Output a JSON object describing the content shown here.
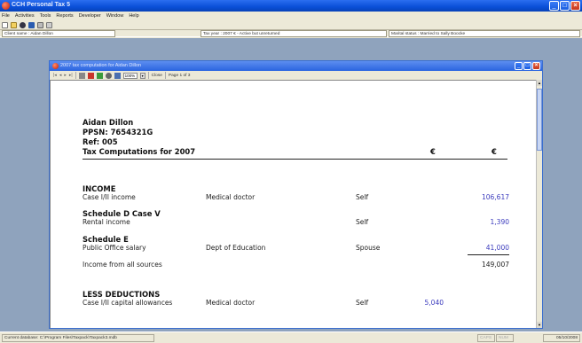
{
  "app": {
    "title": "CCH Personal Tax 5",
    "menu": [
      "File",
      "Activities",
      "Tools",
      "Reports",
      "Developer",
      "Window",
      "Help"
    ],
    "toolbar_icons": [
      "new-icon",
      "open-icon",
      "person-icon",
      "save-icon",
      "print-icon",
      "print-preview-icon"
    ]
  },
  "info": {
    "client": "Client name : Aidan Dillon",
    "taxyear": "Tax year : 2007 € - Active but unreturned",
    "marital": "Marital status : Married to Sally Boocke"
  },
  "child": {
    "title": "2007 tax computation for Aidan Dillon",
    "zoom": "100%",
    "close_label": "Close",
    "page_label": "Page 1 of 3"
  },
  "report": {
    "name": "Aidan Dillon",
    "ppsn": "PPSN: 7654321G",
    "ref": "Ref: 005",
    "title": "Tax Computations for 2007",
    "currency1": "€",
    "currency2": "€",
    "income_header": "INCOME",
    "rows": [
      {
        "label": "Case I/II income",
        "source": "Medical doctor",
        "who": "Self",
        "amount": "106,617"
      },
      {
        "label": "Rental income",
        "source": "",
        "who": "Self",
        "amount": "1,390"
      },
      {
        "label": "Public Office salary",
        "source": "Dept of Education",
        "who": "Spouse",
        "amount": "41,000"
      }
    ],
    "sched_d": "Schedule D Case V",
    "sched_e": "Schedule E",
    "total_label": "Income from all sources",
    "total_amount": "149,007",
    "less_header": "LESS DEDUCTIONS",
    "deduction": {
      "label": "Case I/II capital allowances",
      "source": "Medical doctor",
      "who": "Self",
      "amount": "5,040"
    }
  },
  "status": {
    "db": "Current database: C:\\Program Files\\Taxpack\\Taxpack3.mdb",
    "caps": "CAPS",
    "num": "NUM",
    "date": "05/10/2008"
  },
  "colors": {
    "accent": "#0a4fd8",
    "amount": "#3b3bbd",
    "workspace": "#8fa3bd"
  }
}
